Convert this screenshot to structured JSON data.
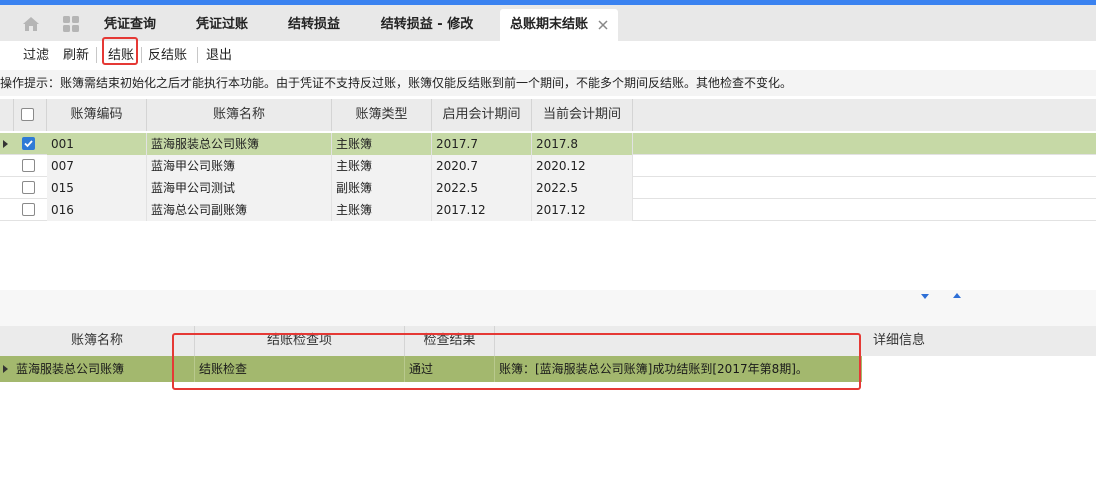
{
  "tabs": [
    {
      "label": "凭证查询"
    },
    {
      "label": "凭证过账"
    },
    {
      "label": "结转损益"
    },
    {
      "label": "结转损益 - 修改"
    },
    {
      "label": "总账期末结账"
    }
  ],
  "toolbar": {
    "filter": "过滤",
    "refresh": "刷新",
    "close_books": "结账",
    "reverse_close": "反结账",
    "exit": "退出"
  },
  "tip": "操作提示：账簿需结束初始化之后才能执行本功能。由于凭证不支持反过账，账簿仅能反结账到前一个期间，不能多个期间反结账。其他检查不变化。",
  "ledger_table": {
    "columns": [
      "账簿编码",
      "账簿名称",
      "账簿类型",
      "启用会计期间",
      "当前会计期间"
    ],
    "rows": [
      {
        "code": "001",
        "name": "蓝海服装总公司账簿",
        "type": "主账簿",
        "start": "2017.7",
        "current": "2017.8",
        "checked": true
      },
      {
        "code": "007",
        "name": "蓝海甲公司账簿",
        "type": "主账簿",
        "start": "2020.7",
        "current": "2020.12",
        "checked": false
      },
      {
        "code": "015",
        "name": "蓝海甲公司测试",
        "type": "副账簿",
        "start": "2022.5",
        "current": "2022.5",
        "checked": false
      },
      {
        "code": "016",
        "name": "蓝海总公司副账簿",
        "type": "主账簿",
        "start": "2017.12",
        "current": "2017.12",
        "checked": false
      }
    ]
  },
  "result_table": {
    "columns": [
      "账簿名称",
      "结账检查项",
      "检查结果",
      "详细信息"
    ],
    "rows": [
      {
        "ledger": "蓝海服装总公司账簿",
        "item": "结账检查",
        "result": "通过",
        "detail": "账簿：[蓝海服装总公司账簿]成功结账到[2017年第8期]。"
      }
    ]
  },
  "colors": {
    "accent": "#3a82f0",
    "selected_row": "#c6d9a6",
    "result_row": "#a3b86e",
    "highlight": "#e53935"
  }
}
